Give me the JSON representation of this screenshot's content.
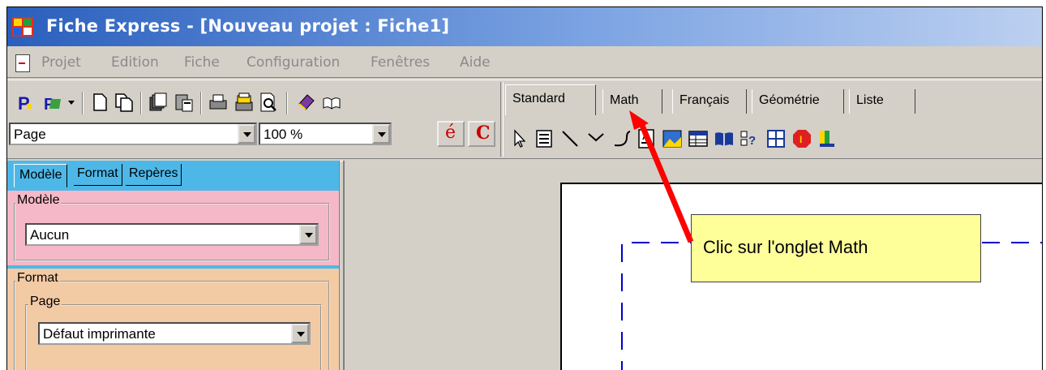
{
  "window": {
    "title": "Fiche Express - [Nouveau projet : Fiche1]"
  },
  "menu": {
    "items": [
      "Projet",
      "Edition",
      "Fiche",
      "Configuration",
      "Fenêtres",
      "Aide"
    ]
  },
  "toolbar": {
    "page_combo": "Page",
    "zoom_combo": "100 %",
    "accent_button": "é",
    "c_button": "C"
  },
  "tabs": [
    "Standard",
    "Math",
    "Français",
    "Géométrie",
    "Liste"
  ],
  "active_tab": "Standard",
  "panel": {
    "tabs": [
      "Modèle",
      "Format",
      "Repères"
    ],
    "modele_group": "Modèle",
    "modele_value": "Aucun",
    "format_group": "Format",
    "page_group": "Page",
    "page_value": "Défaut imprimante"
  },
  "callout": {
    "text": "Clic sur l'onglet Math"
  },
  "colors": {
    "title_start": "#2a5fbd",
    "panel_tab_bg": "#4db8e8",
    "modele_bg": "#f5b8c8",
    "format_bg": "#f2caa4",
    "callout_bg": "#ffff99",
    "arrow": "#ff0000",
    "page_margin": "#0000cc"
  }
}
